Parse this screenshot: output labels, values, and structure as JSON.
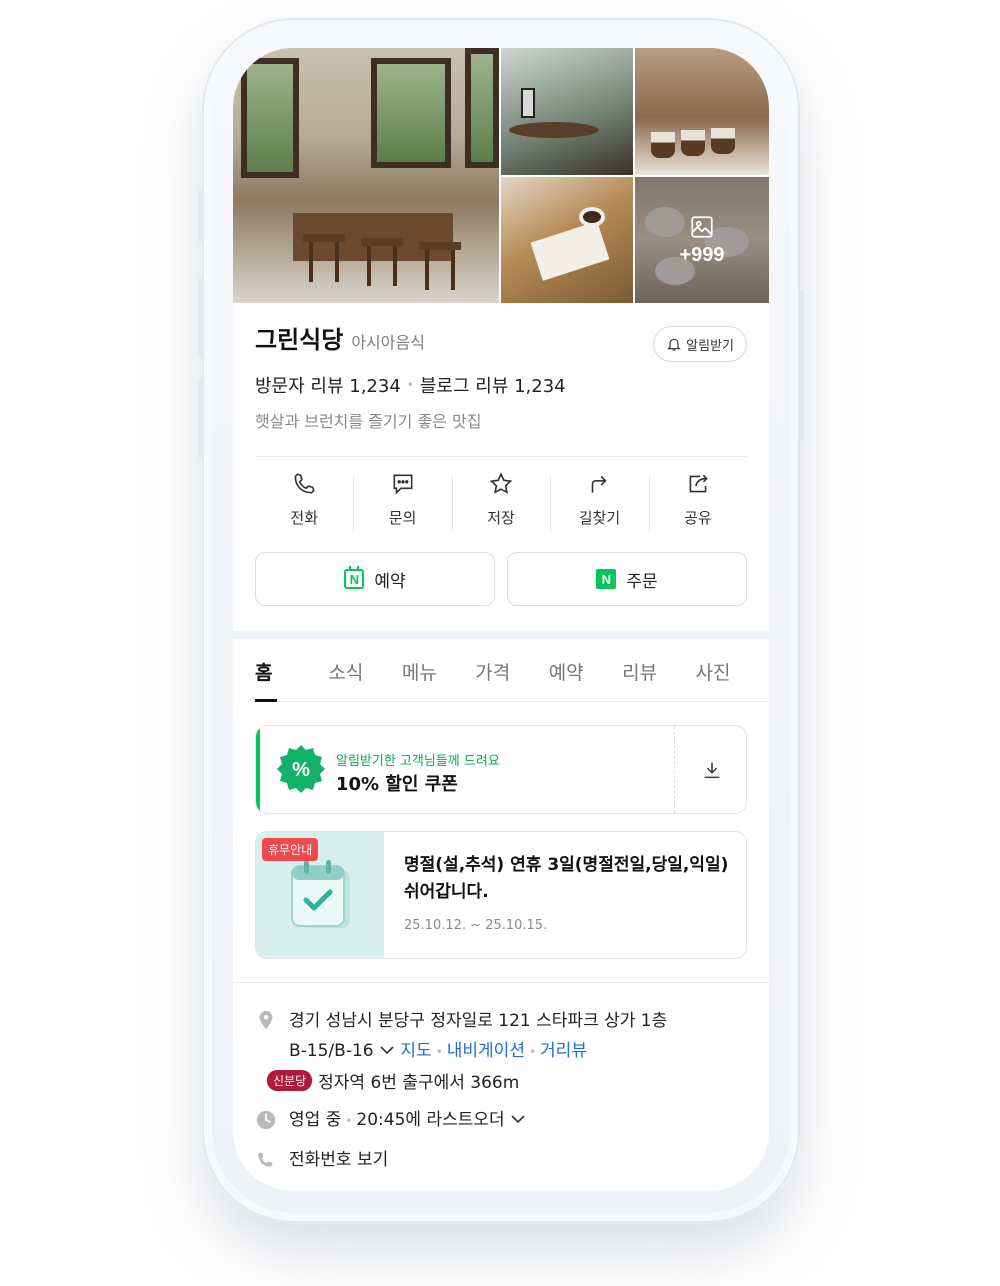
{
  "photos": {
    "more_count": "+999"
  },
  "place": {
    "name": "그린식당",
    "category": "아시아음식",
    "notify_label": "알림받기",
    "visitor_reviews": "방문자 리뷰 1,234",
    "blog_reviews": "블로그 리뷰 1,234",
    "description": "햇살과 브런치를 즐기기 좋은 맛집"
  },
  "actions": [
    {
      "label": "전화",
      "icon": "phone-icon"
    },
    {
      "label": "문의",
      "icon": "chat-icon"
    },
    {
      "label": "저장",
      "icon": "star-icon"
    },
    {
      "label": "길찾기",
      "icon": "directions-icon"
    },
    {
      "label": "공유",
      "icon": "share-icon"
    }
  ],
  "cta": {
    "reserve_label": "예약",
    "order_label": "주문",
    "brand_color": "#03c75a"
  },
  "tabs": [
    "홈",
    "소식",
    "메뉴",
    "가격",
    "예약",
    "리뷰",
    "사진"
  ],
  "active_tab": "홈",
  "coupon": {
    "symbol": "%",
    "subtitle": "알림받기한 고객님들께 드려요",
    "title": "10% 할인 쿠폰"
  },
  "closure": {
    "badge": "휴무안내",
    "text": "명절(설,추석) 연휴 3일(명절전일,당일,익일) 쉬어갑니다.",
    "dates": "25.10.12. ~ 25.10.15."
  },
  "details": {
    "address_line1": "경기 성남시 분당구 정자일로 121 스타파크 상가 1층",
    "address_line2": "B-15/B-16",
    "map_link": "지도",
    "navi_link": "내비게이션",
    "street_view_link": "거리뷰",
    "subway_line": "신분당",
    "subway_text": "정자역 6번 출구에서 366m",
    "hours_status": "영업 중",
    "hours_text": "20:45에 라스트오더",
    "phone_text": "전화번호 보기",
    "subway_color": "#b0193a"
  }
}
